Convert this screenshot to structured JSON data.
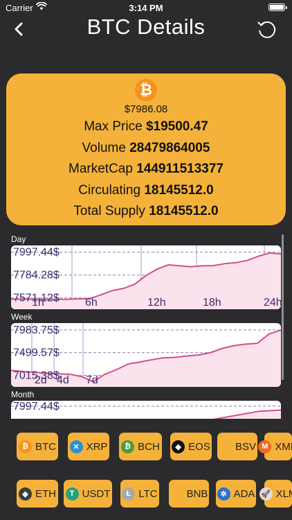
{
  "status_bar": {
    "carrier": "Carrier",
    "time": "3:14 PM"
  },
  "nav": {
    "title": "BTC Details"
  },
  "coin": {
    "symbol_glyph": "₿",
    "price": "$7986.08",
    "rows": [
      {
        "label": "Max Price",
        "value": "$19500.47"
      },
      {
        "label": "Volume",
        "value": "28479864005"
      },
      {
        "label": "MarketCap",
        "value": "144911513377"
      },
      {
        "label": "Circulating",
        "value": "18145512.0"
      },
      {
        "label": "Total Supply",
        "value": "18145512.0"
      }
    ]
  },
  "chart_data": [
    {
      "type": "area",
      "title": "Day",
      "y_tick_labels": [
        "7997.44$",
        "7784.28$",
        "7571.12$"
      ],
      "y_ticks": [
        7997.44,
        7784.28,
        7571.12
      ],
      "x_tick_labels": [
        "1h",
        "6h",
        "12h",
        "18h",
        "24h"
      ],
      "ylim": [
        7466,
        8060
      ],
      "x": [
        0,
        1,
        2,
        3,
        4,
        5,
        6,
        7,
        8,
        9,
        10,
        11,
        12,
        13,
        14,
        15,
        16,
        17,
        18,
        19,
        20,
        21,
        22,
        23,
        24
      ],
      "values": [
        7560,
        7560,
        7559,
        7559,
        7558,
        7559,
        7563,
        7565,
        7600,
        7640,
        7660,
        7700,
        7780,
        7840,
        7880,
        7870,
        7862,
        7870,
        7872,
        7890,
        7900,
        7920,
        7960,
        7990,
        7980
      ],
      "line_color": "#d34d86",
      "fill_color": "#fbe3ee"
    },
    {
      "type": "area",
      "title": "Week",
      "y_tick_labels": [
        "7983.75$",
        "7499.57$",
        "7015.38$"
      ],
      "y_ticks": [
        7983.75,
        7499.57,
        7015.38
      ],
      "x_tick_labels": [
        "2d",
        "4d",
        "7d"
      ],
      "ylim": [
        6770,
        8130
      ],
      "x": [
        0,
        1,
        2,
        3,
        4,
        5,
        6,
        7,
        8,
        9,
        10,
        11,
        12,
        13,
        14,
        15,
        16,
        17,
        18,
        19,
        20,
        21,
        22,
        23
      ],
      "values": [
        7120,
        7100,
        7080,
        7060,
        7050,
        7040,
        6990,
        6880,
        7040,
        7140,
        7260,
        7300,
        7350,
        7390,
        7400,
        7430,
        7450,
        7500,
        7590,
        7650,
        7680,
        7700,
        7900,
        7980
      ],
      "line_color": "#d34d86",
      "fill_color": "#fbe3ee"
    },
    {
      "type": "area",
      "title": "Month",
      "y_tick_labels": [
        "7997.44$"
      ],
      "y_ticks": [
        7997.44
      ],
      "x_tick_labels": [],
      "ylim": [
        5800,
        8200
      ],
      "x": [
        0,
        1,
        2,
        3,
        4,
        5,
        6,
        7,
        8,
        9,
        10,
        11,
        12
      ],
      "values": [
        6900,
        6900,
        6950,
        7000,
        7050,
        7100,
        7150,
        7200,
        7300,
        7500,
        7650,
        7800,
        7850
      ],
      "line_color": "#d34d86",
      "fill_color": "#fbe3ee"
    }
  ],
  "coins_row1": [
    {
      "label": "BTC",
      "icon": "bitcoin-icon",
      "glyph": "₿",
      "color": "#f7931a"
    },
    {
      "label": "XRP",
      "icon": "xrp-icon",
      "glyph": "✕",
      "color": "#2a8fd8"
    },
    {
      "label": "BCH",
      "icon": "bitcoin-cash-icon",
      "glyph": "₿",
      "color": "#4a9b3b"
    },
    {
      "label": "EOS",
      "icon": "eos-icon",
      "glyph": "◆",
      "color": "#111111"
    },
    {
      "label": "BSV",
      "icon": "bsv-icon",
      "glyph": "",
      "color": "#f5b23a"
    },
    {
      "label": "XMR",
      "icon": "monero-icon",
      "glyph": "M",
      "color": "#f26822"
    }
  ],
  "coins_row2": [
    {
      "label": "ETH",
      "icon": "ethereum-icon",
      "glyph": "◆",
      "color": "#3c3c3d"
    },
    {
      "label": "USDT",
      "icon": "tether-icon",
      "glyph": "T",
      "color": "#26a17b"
    },
    {
      "label": "LTC",
      "icon": "litecoin-icon",
      "glyph": "Ł",
      "color": "#a6a9aa"
    },
    {
      "label": "BNB",
      "icon": "bnb-icon",
      "glyph": "",
      "color": "#f5b23a"
    },
    {
      "label": "ADA",
      "icon": "cardano-icon",
      "glyph": "✲",
      "color": "#2a71d0"
    },
    {
      "label": "XLM",
      "icon": "stellar-icon",
      "glyph": "🚀",
      "color": "#dddddd"
    }
  ]
}
